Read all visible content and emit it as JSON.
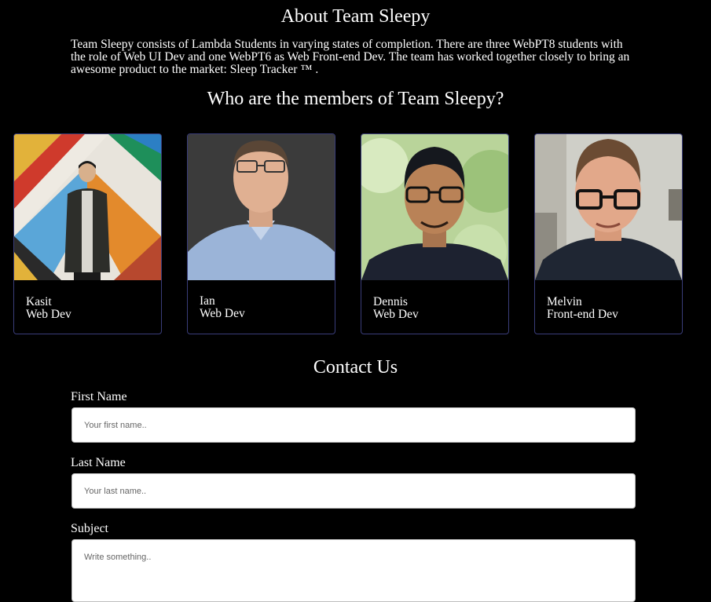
{
  "about": {
    "title": "About Team Sleepy",
    "text": "Team Sleepy consists of Lambda Students in varying states of completion. There are three WebPT8 students with the role of Web UI Dev and one WebPT6 as Web Front-end Dev. The team has worked together closely to bring an awesome product to the market: Sleep Tracker ™ ."
  },
  "members": {
    "title": "Who are the members of Team Sleepy?",
    "list": [
      {
        "name": "Kasit",
        "role": "Web Dev"
      },
      {
        "name": "Ian",
        "role": "Web Dev"
      },
      {
        "name": "Dennis",
        "role": "Web Dev"
      },
      {
        "name": "Melvin",
        "role": "Front-end Dev"
      }
    ]
  },
  "contact": {
    "title": "Contact Us",
    "first_name": {
      "label": "First Name",
      "placeholder": "Your first name.."
    },
    "last_name": {
      "label": "Last Name",
      "placeholder": "Your last name.."
    },
    "subject": {
      "label": "Subject",
      "placeholder": "Write something.."
    }
  },
  "colors": {
    "background": "#000000",
    "card_border": "#3a3d7a",
    "text": "#ffffff"
  }
}
